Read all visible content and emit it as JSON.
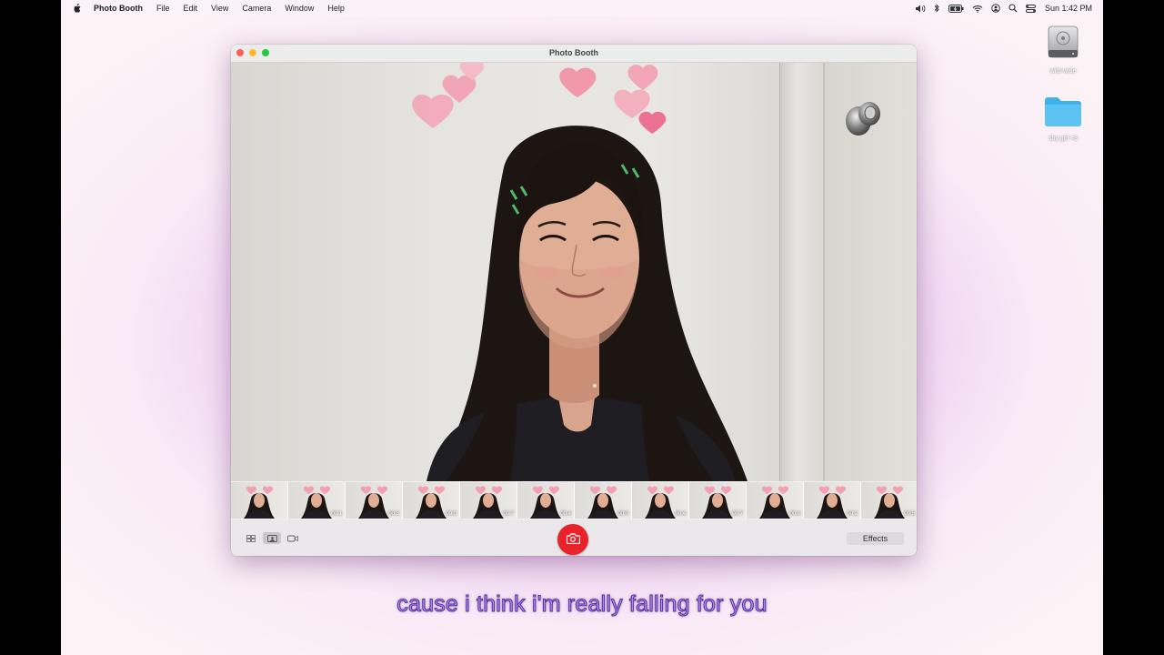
{
  "menubar": {
    "app_name": "Photo Booth",
    "items": [
      "File",
      "Edit",
      "View",
      "Camera",
      "Window",
      "Help"
    ],
    "clock": "Sun 1:42 PM",
    "status_icons": [
      "volume-icon",
      "bluetooth-icon",
      "battery-icon",
      "wifi-icon",
      "user-icon",
      "search-icon",
      "control-center-icon"
    ]
  },
  "desktop": {
    "icons": [
      {
        "label": "wild-wide",
        "icon": "hard-drive-icon"
      },
      {
        "label": "shy girl <3",
        "icon": "folder-icon"
      }
    ]
  },
  "window": {
    "title": "Photo Booth"
  },
  "filmstrip": {
    "durations": [
      "",
      "00:1",
      "00:3",
      "00:0",
      "00:7",
      "00:4",
      "00:0",
      "00:4",
      "00:7",
      "00:4",
      "00:2",
      "00:5"
    ]
  },
  "toolbar": {
    "effects_label": "Effects",
    "view_modes": [
      "grid-view-icon",
      "single-photo-icon",
      "video-icon"
    ]
  },
  "subtitle": "cause i think i'm really falling for you",
  "colors": {
    "shutter": "#e8232a",
    "folder": "#5cc3f3",
    "subtitle_fill": "#b58ee8",
    "subtitle_stroke": "#5a2fa0"
  }
}
